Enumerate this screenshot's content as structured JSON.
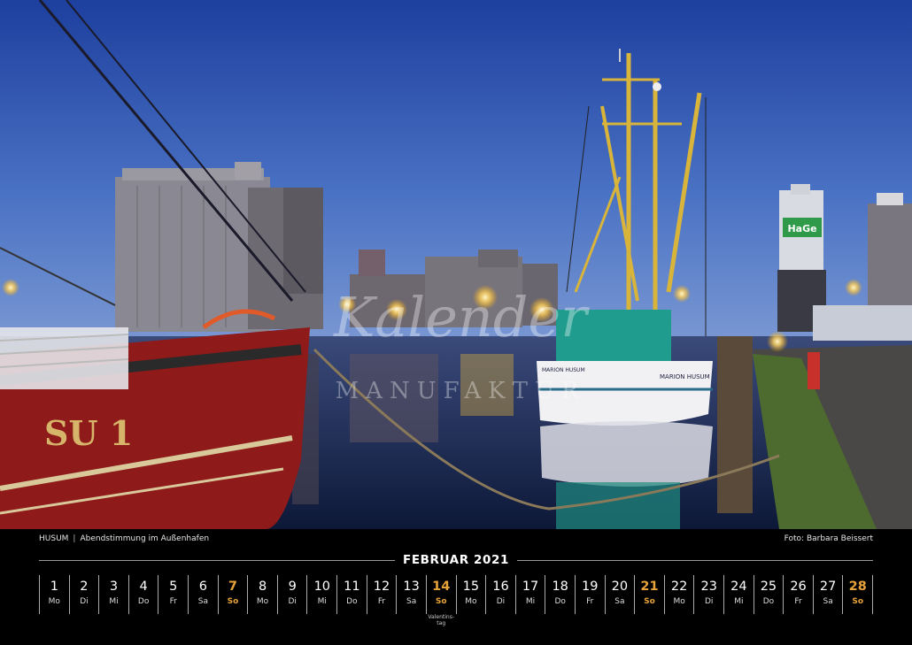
{
  "photo": {
    "boat_hull_text": "SU 1",
    "boat2_name_left": "MARION HUSUM",
    "boat2_name_right": "MARION HUSUM",
    "silo_sign": "HaGe",
    "watermark_script": "Kalender",
    "watermark_caps": "MANUFAKTUR"
  },
  "caption": {
    "place": "HUSUM",
    "separator": "|",
    "description": "Abendstimmung im Außenhafen",
    "credit": "Foto: Barbara Beissert"
  },
  "calendar": {
    "title": "FEBRUAR 2021",
    "days": [
      {
        "num": "1",
        "wd": "Mo"
      },
      {
        "num": "2",
        "wd": "Di"
      },
      {
        "num": "3",
        "wd": "Mi"
      },
      {
        "num": "4",
        "wd": "Do"
      },
      {
        "num": "5",
        "wd": "Fr"
      },
      {
        "num": "6",
        "wd": "Sa"
      },
      {
        "num": "7",
        "wd": "So"
      },
      {
        "num": "8",
        "wd": "Mo"
      },
      {
        "num": "9",
        "wd": "Di"
      },
      {
        "num": "10",
        "wd": "Mi"
      },
      {
        "num": "11",
        "wd": "Do"
      },
      {
        "num": "12",
        "wd": "Fr"
      },
      {
        "num": "13",
        "wd": "Sa"
      },
      {
        "num": "14",
        "wd": "So",
        "note": "Valentins- tag"
      },
      {
        "num": "15",
        "wd": "Mo"
      },
      {
        "num": "16",
        "wd": "Di"
      },
      {
        "num": "17",
        "wd": "Mi"
      },
      {
        "num": "18",
        "wd": "Do"
      },
      {
        "num": "19",
        "wd": "Fr"
      },
      {
        "num": "20",
        "wd": "Sa"
      },
      {
        "num": "21",
        "wd": "So"
      },
      {
        "num": "22",
        "wd": "Mo"
      },
      {
        "num": "23",
        "wd": "Di"
      },
      {
        "num": "24",
        "wd": "Mi"
      },
      {
        "num": "25",
        "wd": "Do"
      },
      {
        "num": "26",
        "wd": "Fr"
      },
      {
        "num": "27",
        "wd": "Sa"
      },
      {
        "num": "28",
        "wd": "So"
      }
    ]
  },
  "colors": {
    "sunday": "#e8a23a",
    "background": "#000000",
    "hull_red": "#8e1a1a",
    "hull_teal": "#1f9c8e"
  }
}
